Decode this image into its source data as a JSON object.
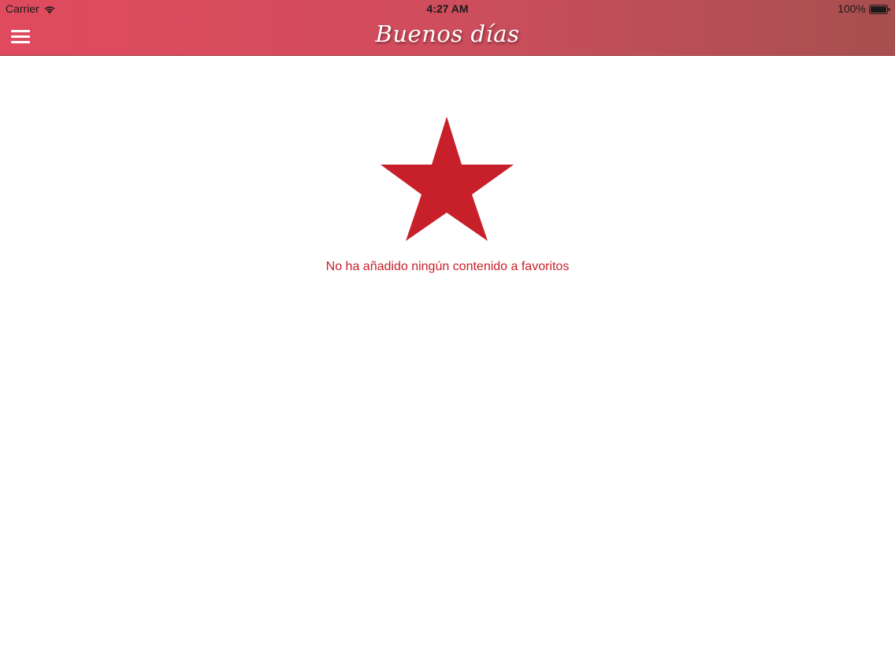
{
  "status_bar": {
    "carrier": "Carrier",
    "time": "4:27 AM",
    "battery": "100%",
    "wifi_icon": "wifi-icon",
    "battery_icon": "battery-full-icon"
  },
  "nav": {
    "title": "Buenos días",
    "menu_icon": "hamburger-menu-icon"
  },
  "favorites": {
    "empty_icon": "star-icon",
    "empty_message": "No ha añadido ningún contenido a favoritos"
  },
  "colors": {
    "nav_gradient_start": "#e04a5e",
    "nav_gradient_end": "#a74f4f",
    "accent_red": "#c8202a",
    "background": "#ffffff"
  }
}
